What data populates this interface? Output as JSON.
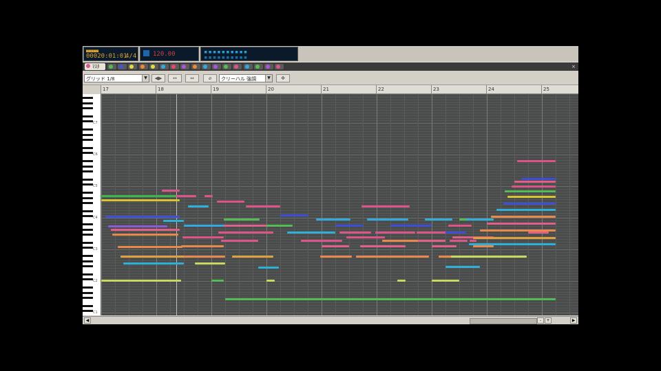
{
  "transport": {
    "position_lcd": "00020:01:01",
    "position_sub": "4/4",
    "tempo_lcd": "120.00",
    "meter_lcd": "▪▪▪▪▪▪▪▪▪▪"
  },
  "tabs": {
    "active_label": "ﾏｽﾀ",
    "track_colors": [
      "#55bb55",
      "#4455dd",
      "#dddd44",
      "#ee8833",
      "#dddd44",
      "#33aadd",
      "#ee4466",
      "#aa55dd",
      "#ee8833",
      "#33aadd",
      "#aa55dd",
      "#55bb55",
      "#dd5588",
      "#33aadd",
      "#55bb55",
      "#aa55dd",
      "#dd5588"
    ]
  },
  "toolbar": {
    "snap_value": "グリッド 1/8",
    "quantize_value": "クリーハル 強調",
    "btn1": "◀▶",
    "btn2": "↔",
    "btn3": "⇔",
    "btn4": "⌀",
    "btn5": "✥"
  },
  "ruler": {
    "bars": [
      "17",
      "18",
      "19",
      "20",
      "21",
      "22",
      "23",
      "24",
      "25"
    ]
  },
  "keyboard": {
    "octaves": [
      "C7",
      "C6",
      "C5",
      "C4",
      "C3",
      "C2",
      "C1"
    ]
  },
  "colors": {
    "grid_bg": "#4a4c4b",
    "playhead": "#bcbcbc"
  }
}
